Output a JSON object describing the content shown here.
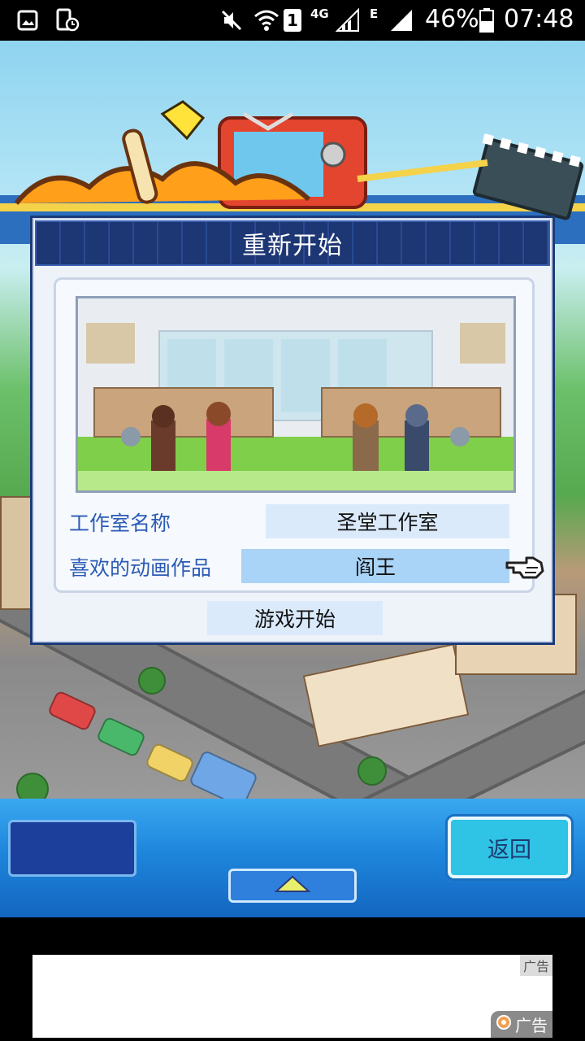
{
  "status_bar": {
    "network_4g": "4G",
    "network_e": "E",
    "sim_number": "1",
    "battery_percent": "46%",
    "time": "07:48",
    "icons": [
      "image-icon",
      "phone-timer-icon",
      "mute-icon",
      "wifi-icon",
      "sim-icon",
      "signal-icon",
      "signal-icon-2",
      "battery-icon"
    ]
  },
  "dialog": {
    "title": "重新开始",
    "studio_name_label": "工作室名称",
    "studio_name_value": "圣堂工作室",
    "favorite_anime_label": "喜欢的动画作品",
    "favorite_anime_value": "阎王",
    "start_button": "游戏开始"
  },
  "bottom_panel": {
    "back_button": "返回"
  },
  "ad": {
    "tag": "广告",
    "mark": "广告"
  },
  "colors": {
    "dialog_header": "#1d3674",
    "label_blue": "#2b5bb5",
    "field_bg": "#dbeafb",
    "field_selected_bg": "#a9d3f7",
    "back_button": "#2fc3e6"
  }
}
